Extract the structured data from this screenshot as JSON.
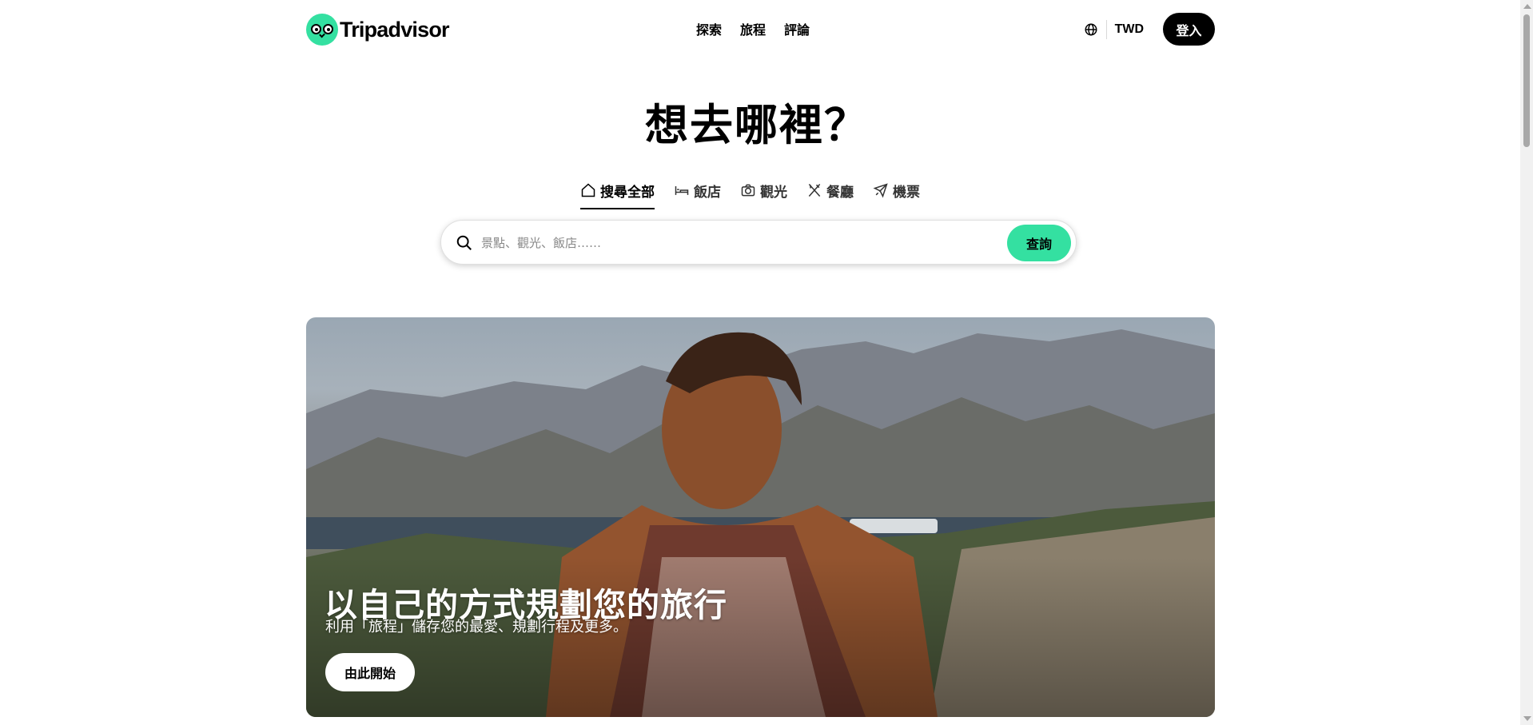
{
  "header": {
    "logo_text": "Tripadvisor",
    "nav": [
      "探索",
      "旅程",
      "評論"
    ],
    "language_icon": "globe-icon",
    "currency": "TWD",
    "login_label": "登入"
  },
  "hero": {
    "title": "想去哪裡？"
  },
  "tabs": [
    {
      "label": "搜尋全部",
      "icon": "home-icon",
      "active": true
    },
    {
      "label": "飯店",
      "icon": "bed-icon",
      "active": false
    },
    {
      "label": "觀光",
      "icon": "camera-icon",
      "active": false
    },
    {
      "label": "餐廳",
      "icon": "utensils-icon",
      "active": false
    },
    {
      "label": "機票",
      "icon": "plane-icon",
      "active": false
    }
  ],
  "search": {
    "placeholder": "景點、觀光、飯店……",
    "button_label": "查詢"
  },
  "banner": {
    "title": "以自己的方式規劃您的旅行",
    "subtitle": "利用「旅程」儲存您的最愛、規劃行程及更多。",
    "button_label": "由此開始"
  },
  "colors": {
    "brand_green": "#34e0a1",
    "text": "#000000",
    "button_dark": "#000000"
  }
}
